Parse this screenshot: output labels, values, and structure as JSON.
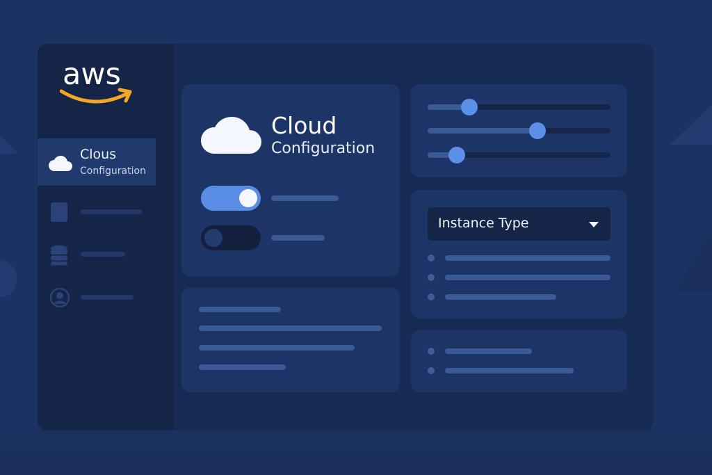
{
  "brand": {
    "logo_text": "aws",
    "logo_color": "#ffffff",
    "smile_color": "#f5a623"
  },
  "sidebar": {
    "active_item": {
      "icon": "cloud-icon",
      "label_line1": "Clous",
      "label_line2": "Configuration"
    },
    "items": [
      {
        "icon": "document-icon"
      },
      {
        "icon": "database-icon"
      },
      {
        "icon": "user-icon"
      }
    ]
  },
  "main": {
    "header": {
      "icon": "cloud-icon",
      "title": "Cloud",
      "subtitle": "Configuration"
    },
    "toggles": [
      {
        "state": "on",
        "accent": "#5a8ee6"
      },
      {
        "state": "off"
      }
    ],
    "sliders": [
      {
        "value": 0.23
      },
      {
        "value": 0.6
      },
      {
        "value": 0.16
      }
    ],
    "instance_select": {
      "label": "Instance Type",
      "icon": "chevron-down-icon"
    }
  },
  "colors": {
    "background": "#1c3263",
    "window": "#172a53",
    "card": "#1d3566",
    "accent": "#5c8fe8"
  }
}
